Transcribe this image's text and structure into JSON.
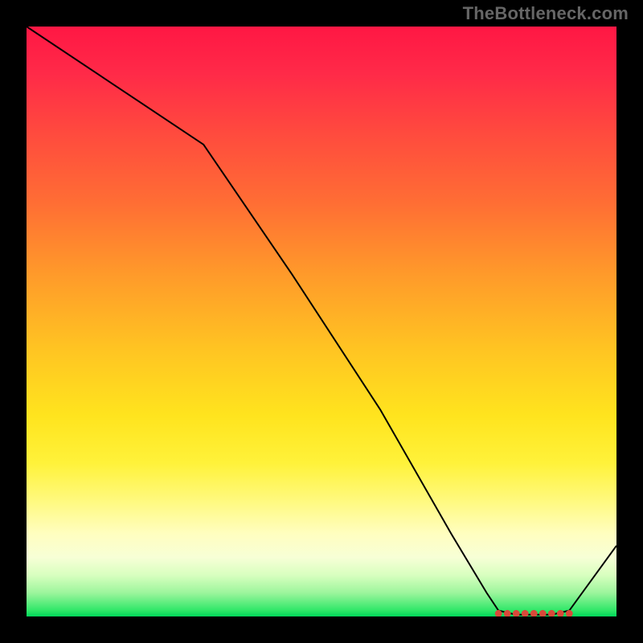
{
  "watermark": "TheBottleneck.com",
  "chart_data": {
    "type": "line",
    "title": "",
    "xlabel": "",
    "ylabel": "",
    "xlim": [
      0,
      100
    ],
    "ylim": [
      0,
      100
    ],
    "series": [
      {
        "name": "bottleneck-curve",
        "x": [
          0,
          15,
          30,
          45,
          60,
          72,
          78,
          80,
          83,
          86,
          89,
          92,
          100
        ],
        "values": [
          100,
          90,
          80,
          58,
          35,
          14,
          4,
          1,
          0.3,
          0.3,
          0.3,
          1,
          12
        ]
      }
    ],
    "markers": {
      "name": "optimal-range-dots",
      "x": [
        80,
        81.5,
        83,
        84.5,
        86,
        87.5,
        89,
        90.5,
        92
      ],
      "values": [
        0.5,
        0.5,
        0.5,
        0.5,
        0.5,
        0.5,
        0.5,
        0.5,
        0.5
      ],
      "color": "#d94a3a"
    },
    "gradient_stops": [
      {
        "pos": 0,
        "color": "#ff1744"
      },
      {
        "pos": 30,
        "color": "#ff6e34"
      },
      {
        "pos": 55,
        "color": "#ffc522"
      },
      {
        "pos": 80,
        "color": "#fff97a"
      },
      {
        "pos": 95,
        "color": "#9cf59c"
      },
      {
        "pos": 100,
        "color": "#00d85a"
      }
    ]
  }
}
